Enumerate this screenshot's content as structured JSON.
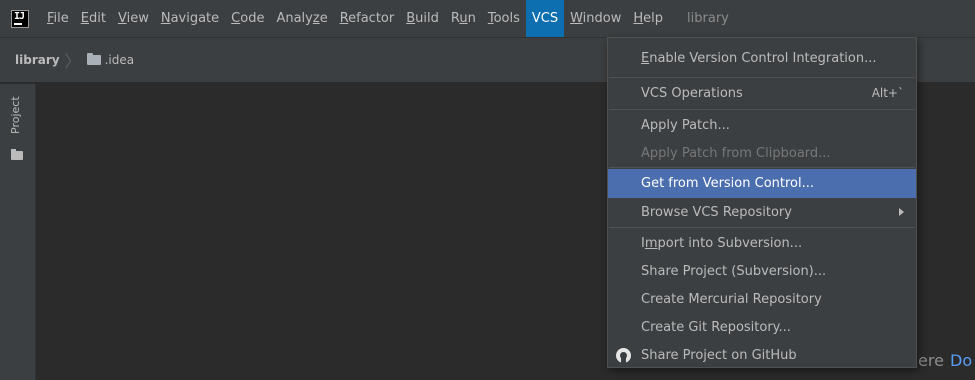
{
  "menubar": {
    "items": [
      {
        "pre": "",
        "ul": "F",
        "post": "ile"
      },
      {
        "pre": "",
        "ul": "E",
        "post": "dit"
      },
      {
        "pre": "",
        "ul": "V",
        "post": "iew"
      },
      {
        "pre": "",
        "ul": "N",
        "post": "avigate"
      },
      {
        "pre": "",
        "ul": "C",
        "post": "ode"
      },
      {
        "pre": "Analy",
        "ul": "z",
        "post": "e"
      },
      {
        "pre": "",
        "ul": "R",
        "post": "efactor"
      },
      {
        "pre": "",
        "ul": "B",
        "post": "uild"
      },
      {
        "pre": "R",
        "ul": "u",
        "post": "n"
      },
      {
        "pre": "",
        "ul": "T",
        "post": "ools"
      },
      {
        "pre": "VCS",
        "ul": "",
        "post": ""
      },
      {
        "pre": "",
        "ul": "W",
        "post": "indow"
      },
      {
        "pre": "",
        "ul": "H",
        "post": "elp"
      }
    ],
    "project_name": "library"
  },
  "breadcrumb": {
    "root": "library",
    "folder": ".idea"
  },
  "sidebar": {
    "project_label": "Project"
  },
  "editor": {
    "hint_text": "ere",
    "hint_link": "Do"
  },
  "vcs_menu": {
    "enable_pre": "",
    "enable_ul": "E",
    "enable_post": "nable Version Control Integration...",
    "operations": "VCS Operations",
    "operations_shortcut": "Alt+`",
    "apply_patch": "Apply Patch...",
    "apply_patch_clipboard": "Apply Patch from Clipboard...",
    "get_from_vcs": "Get from Version Control...",
    "browse_repo": "Browse VCS Repository",
    "import_pre": "I",
    "import_ul": "m",
    "import_post": "port into Subversion...",
    "share_svn": "Share Project (Subversion)...",
    "create_hg": "Create Mercurial Repository",
    "create_git": "Create Git Repository...",
    "share_github": "Share Project on GitHub"
  },
  "colors": {
    "menu_active": "#0d6fb0",
    "selected_item": "#4b6eaf",
    "background": "#2b2b2b",
    "panel": "#3c3f41"
  }
}
